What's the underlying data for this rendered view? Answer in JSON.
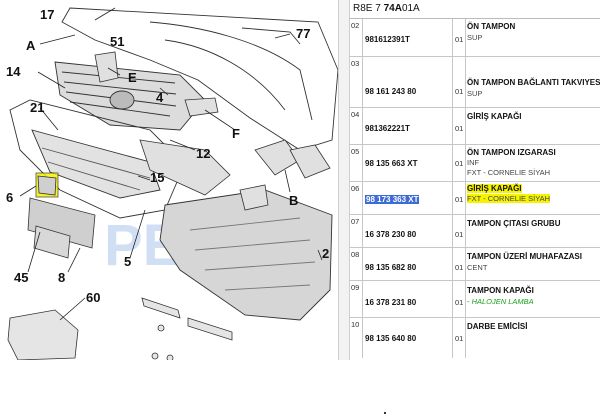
{
  "header": {
    "code_prefix": "R8E 7",
    "code_bold": "74A",
    "code_suffix": "01A"
  },
  "diagram": {
    "labels": {
      "l17": "17",
      "lA": "A",
      "l51": "51",
      "lE": "E",
      "l14": "14",
      "l4": "4",
      "l77": "77",
      "l21": "21",
      "lF": "F",
      "l12": "12",
      "l6": "6",
      "l15": "15",
      "lB": "B",
      "l5": "5",
      "l2": "2",
      "l45": "45",
      "l8": "8",
      "l60": "60"
    },
    "watermark": "PEUOPEL"
  },
  "parts": [
    {
      "idx": "02",
      "pn": "981612391T",
      "qty": "01",
      "name": "ÖN TAMPON",
      "sub": [
        "SUP"
      ]
    },
    {
      "idx": "03",
      "pn": "98 161 243 80",
      "qty": "01",
      "name": "ÖN TAMPON BAĞLANTI TAKVIYES",
      "sub": [
        "SUP"
      ]
    },
    {
      "idx": "04",
      "pn": "981362221T",
      "qty": "01",
      "name": "GİRİŞ KAPAĞI",
      "sub": []
    },
    {
      "idx": "05",
      "pn": "98 135 663 XT",
      "qty": "01",
      "name": "ÖN TAMPON IZGARASI",
      "sub": [
        "INF",
        "FXT - CORNELIE SİYAH"
      ]
    },
    {
      "idx": "06",
      "pn": "98 173 363 XT",
      "qty": "01",
      "name": "GİRİŞ KAPAĞI",
      "sub": [
        "FXT - CORNELIE SİYAH"
      ]
    },
    {
      "idx": "07",
      "pn": "16 378 230 80",
      "qty": "01",
      "name": "TAMPON ÇITASI GRUBU",
      "sub": []
    },
    {
      "idx": "08",
      "pn": "98 135 682 80",
      "qty": "01",
      "name": "TAMPON ÜZERİ MUHAFAZASI",
      "sub": [
        "CENT"
      ]
    },
    {
      "idx": "09",
      "pn": "16 378 231 80",
      "qty": "01",
      "name": "TAMPON KAPAĞI",
      "sub": [
        "- HALOJEN LAMBA"
      ]
    },
    {
      "idx": "10",
      "pn": "98 135 640 80",
      "qty": "01",
      "name": "DARBE EMİCİSİ",
      "sub": []
    }
  ],
  "colors": {
    "highlight": "#f6f300",
    "selection": "#3d6cd6",
    "watermark_blue": "#5b8fd9",
    "watermark_yellow": "#f3cf3d"
  }
}
